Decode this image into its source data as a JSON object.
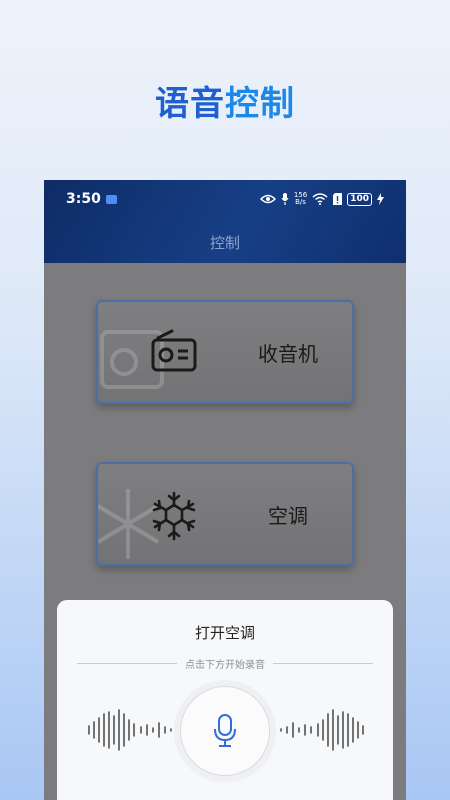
{
  "promo": {
    "title_part1": "语音",
    "title_part2": "控制"
  },
  "status_bar": {
    "time": "3:50",
    "speed_value": "156",
    "speed_unit": "B/s",
    "battery": "100"
  },
  "appbar": {
    "title": "控制"
  },
  "devices": [
    {
      "label": "收音机",
      "icon": "radio-icon"
    },
    {
      "label": "空调",
      "icon": "snowflake-icon"
    }
  ],
  "voice": {
    "command": "打开空调",
    "hint": "点击下方开始录音",
    "mic_icon": "microphone-icon"
  },
  "colors": {
    "accent": "#1e88e8",
    "appbar": "#173f86",
    "card_border": "#4c6ea6",
    "mic": "#2f6fd8"
  }
}
